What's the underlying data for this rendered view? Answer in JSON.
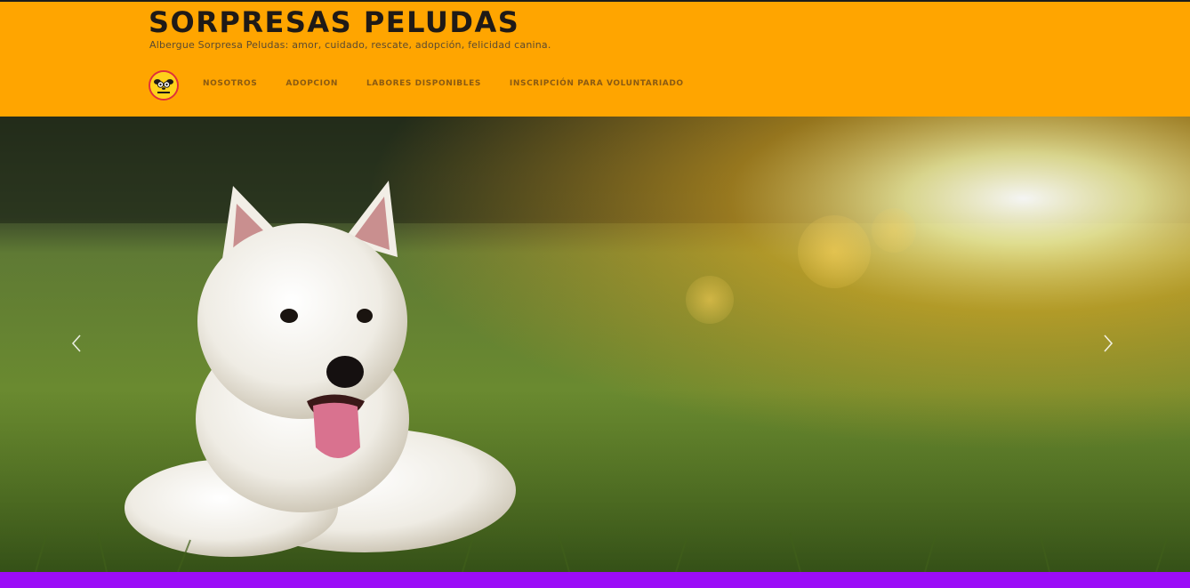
{
  "site": {
    "title": "SORPRESAS PELUDAS",
    "tagline": "Albergue Sorpresa Peludas: amor, cuidado, rescate, adopción, felicidad canina."
  },
  "logo": {
    "icon": "dog-face-logo-icon"
  },
  "nav": {
    "items": [
      {
        "label": "NOSOTROS"
      },
      {
        "label": "ADOPCION"
      },
      {
        "label": "LABORES DISPONIBLES"
      },
      {
        "label": "INSCRIPCIÓN PARA VOLUNTARIADO"
      }
    ]
  },
  "hero": {
    "image": "white-westie-dog-on-grass-photo",
    "prev_icon": "chevron-left-icon",
    "next_icon": "chevron-right-icon"
  },
  "colors": {
    "header_bg": "#ffa500",
    "title_text": "#1f1a17",
    "nav_text": "#8a5a12",
    "footer_bar": "#9b0cf7"
  }
}
